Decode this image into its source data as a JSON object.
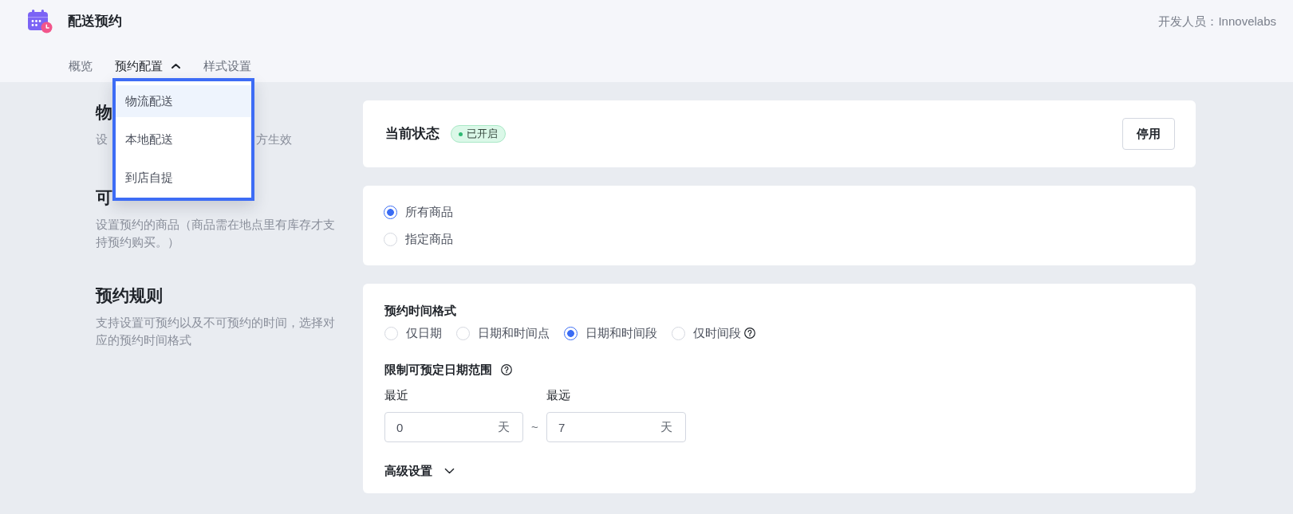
{
  "header": {
    "title": "配送预约",
    "developer": "开发人员：Innovelabs"
  },
  "tabs": [
    {
      "label": "概览",
      "selected": false
    },
    {
      "label": "预约配置",
      "selected": true,
      "expanded": true
    },
    {
      "label": "样式设置",
      "selected": false
    }
  ],
  "tab_menu": [
    {
      "label": "物流配送",
      "selected": true
    },
    {
      "label": "本地配送",
      "selected": false
    },
    {
      "label": "到店自提",
      "selected": false
    }
  ],
  "sections": [
    {
      "title": "物",
      "description": [
        "设",
        "方生效"
      ]
    },
    {
      "title": "可",
      "description": [
        "设置预约的商品（商品需在地点里有库存才支持预约购买。）"
      ]
    },
    {
      "title": "预约规则",
      "description": [
        "支持设置可预约以及不可预约的时间，选择对应的预约时间格式"
      ]
    }
  ],
  "status_card": {
    "label": "当前状态",
    "badge": {
      "label": "已开启",
      "on": true
    },
    "button": "停用"
  },
  "products_card": {
    "options": [
      {
        "label": "所有商品",
        "selected": true
      },
      {
        "label": "指定商品",
        "selected": false
      }
    ]
  },
  "rules_card": {
    "format_label": "预约时间格式",
    "formats": [
      {
        "label": "仅日期",
        "selected": false,
        "help": false
      },
      {
        "label": "日期和时间点",
        "selected": false,
        "help": false
      },
      {
        "label": "日期和时间段",
        "selected": true,
        "help": false
      },
      {
        "label": "仅时间段",
        "selected": false,
        "help": true
      }
    ],
    "range_label": "限制可预定日期范围",
    "range_help": true,
    "range": [
      {
        "label": "最近",
        "value": "0",
        "unit": "天"
      },
      {
        "label": "最远",
        "value": "7",
        "unit": "天"
      }
    ],
    "range_separator": "~",
    "advanced": {
      "label": "高级设置",
      "expanded": false
    }
  }
}
